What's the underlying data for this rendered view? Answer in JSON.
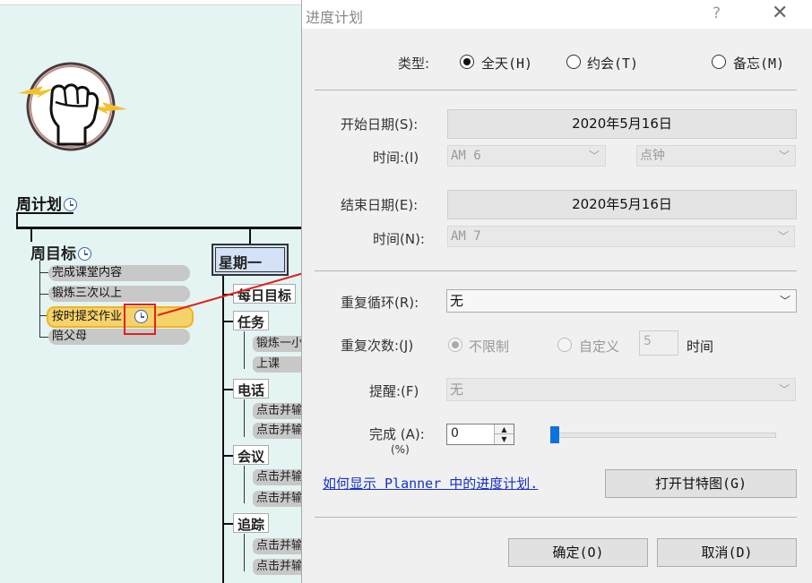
{
  "mindmap": {
    "root": "周计划",
    "goal_title": "周目标",
    "goal_items": [
      "完成课堂内容",
      "锻炼三次以上",
      "按时提交作业",
      "陪父母"
    ],
    "day": "星期一",
    "categories": [
      "每日目标",
      "任务",
      "电话",
      "会议",
      "追踪"
    ],
    "task_items": [
      "锻炼一小",
      "上课"
    ],
    "placeholder_item": "点击并输"
  },
  "dialog": {
    "title": "进度计划",
    "help": "?",
    "close": "✕",
    "type_label": "类型:",
    "type_options": [
      "全天(H)",
      "约会(T)",
      "备忘(M)"
    ],
    "start_date_label": "开始日期(S):",
    "start_date": "2020年5月16日",
    "start_time_label": "时间:(I)",
    "start_time": "AM 6",
    "start_unit": "点钟",
    "end_date_label": "结束日期(E):",
    "end_date": "2020年5月16日",
    "end_time_label": "时间(N):",
    "end_time": "AM 7",
    "repeat_label": "重复循环(R):",
    "repeat_value": "无",
    "repeat_count_label": "重复次数:(J)",
    "repeat_unlimited": "不限制",
    "repeat_custom": "自定义",
    "repeat_custom_value": "5",
    "repeat_unit": "时间",
    "reminder_label": "提醒:(F)",
    "reminder_value": "无",
    "complete_label_1": "完成 (A):",
    "complete_label_2": "(%)",
    "complete_value": "0",
    "complete_fraction": 0,
    "help_link": "如何显示 Planner 中的进度计划.",
    "gantt_button": "打开甘特图(G)",
    "ok_button": "确定(O)",
    "cancel_button": "取消(D)"
  },
  "colors": {
    "accent": "#0a74da",
    "highlight": "#f6d36a",
    "callout": "#e02020",
    "link": "#1432c8"
  },
  "icons": [
    "fist-logo-icon",
    "clock-icon",
    "close-icon",
    "help-icon",
    "chevron-down-icon"
  ]
}
